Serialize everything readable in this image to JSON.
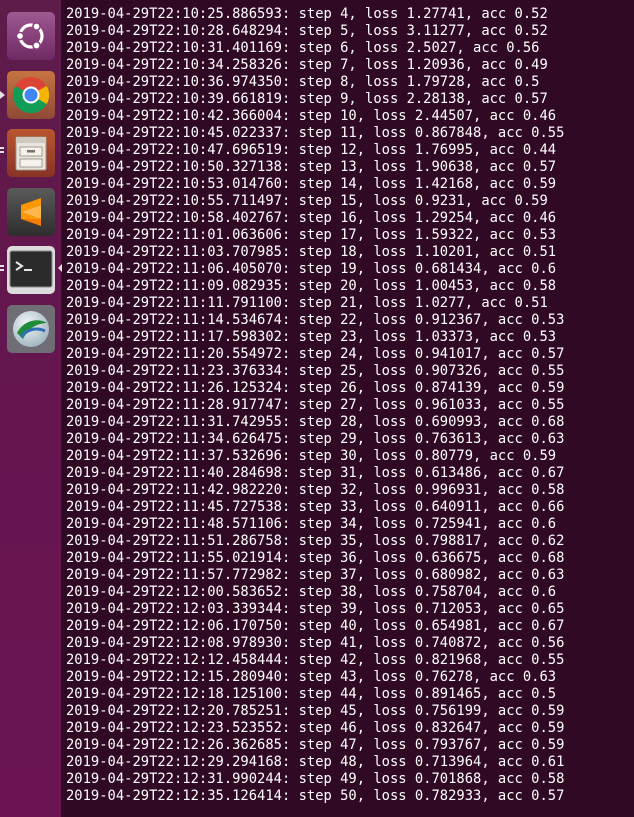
{
  "launcher": {
    "items": [
      {
        "icon": "ubuntu-dash-icon"
      },
      {
        "icon": "chrome-icon"
      },
      {
        "icon": "files-icon"
      },
      {
        "icon": "sublime-text-icon"
      },
      {
        "icon": "terminal-icon"
      },
      {
        "icon": "anyconnect-icon"
      }
    ]
  },
  "colors": {
    "terminal_background": "#300a24",
    "terminal_text": "#ffffff",
    "launcher_background": "#66154f"
  },
  "terminal": {
    "lines": [
      "2019-04-29T22:10:25.886593: step 4, loss 1.27741, acc 0.52",
      "2019-04-29T22:10:28.648294: step 5, loss 3.11277, acc 0.52",
      "2019-04-29T22:10:31.401169: step 6, loss 2.5027, acc 0.56",
      "2019-04-29T22:10:34.258326: step 7, loss 1.20936, acc 0.49",
      "2019-04-29T22:10:36.974350: step 8, loss 1.79728, acc 0.5",
      "2019-04-29T22:10:39.661819: step 9, loss 2.28138, acc 0.57",
      "2019-04-29T22:10:42.366004: step 10, loss 2.44507, acc 0.46",
      "2019-04-29T22:10:45.022337: step 11, loss 0.867848, acc 0.55",
      "2019-04-29T22:10:47.696519: step 12, loss 1.76995, acc 0.44",
      "2019-04-29T22:10:50.327138: step 13, loss 1.90638, acc 0.57",
      "2019-04-29T22:10:53.014760: step 14, loss 1.42168, acc 0.59",
      "2019-04-29T22:10:55.711497: step 15, loss 0.9231, acc 0.59",
      "2019-04-29T22:10:58.402767: step 16, loss 1.29254, acc 0.46",
      "2019-04-29T22:11:01.063606: step 17, loss 1.59322, acc 0.53",
      "2019-04-29T22:11:03.707985: step 18, loss 1.10201, acc 0.51",
      "2019-04-29T22:11:06.405070: step 19, loss 0.681434, acc 0.6",
      "2019-04-29T22:11:09.082935: step 20, loss 1.00453, acc 0.58",
      "2019-04-29T22:11:11.791100: step 21, loss 1.0277, acc 0.51",
      "2019-04-29T22:11:14.534674: step 22, loss 0.912367, acc 0.53",
      "2019-04-29T22:11:17.598302: step 23, loss 1.03373, acc 0.53",
      "2019-04-29T22:11:20.554972: step 24, loss 0.941017, acc 0.57",
      "2019-04-29T22:11:23.376334: step 25, loss 0.907326, acc 0.55",
      "2019-04-29T22:11:26.125324: step 26, loss 0.874139, acc 0.59",
      "2019-04-29T22:11:28.917747: step 27, loss 0.961033, acc 0.55",
      "2019-04-29T22:11:31.742955: step 28, loss 0.690993, acc 0.68",
      "2019-04-29T22:11:34.626475: step 29, loss 0.763613, acc 0.63",
      "2019-04-29T22:11:37.532696: step 30, loss 0.80779, acc 0.59",
      "2019-04-29T22:11:40.284698: step 31, loss 0.613486, acc 0.67",
      "2019-04-29T22:11:42.982220: step 32, loss 0.996931, acc 0.58",
      "2019-04-29T22:11:45.727538: step 33, loss 0.640911, acc 0.66",
      "2019-04-29T22:11:48.571106: step 34, loss 0.725941, acc 0.6",
      "2019-04-29T22:11:51.286758: step 35, loss 0.798817, acc 0.62",
      "2019-04-29T22:11:55.021914: step 36, loss 0.636675, acc 0.68",
      "2019-04-29T22:11:57.772982: step 37, loss 0.680982, acc 0.63",
      "2019-04-29T22:12:00.583652: step 38, loss 0.758704, acc 0.6",
      "2019-04-29T22:12:03.339344: step 39, loss 0.712053, acc 0.65",
      "2019-04-29T22:12:06.170750: step 40, loss 0.654981, acc 0.67",
      "2019-04-29T22:12:08.978930: step 41, loss 0.740872, acc 0.56",
      "2019-04-29T22:12:12.458444: step 42, loss 0.821968, acc 0.55",
      "2019-04-29T22:12:15.280940: step 43, loss 0.76278, acc 0.63",
      "2019-04-29T22:12:18.125100: step 44, loss 0.891465, acc 0.5",
      "2019-04-29T22:12:20.785251: step 45, loss 0.756199, acc 0.59",
      "2019-04-29T22:12:23.523552: step 46, loss 0.832647, acc 0.59",
      "2019-04-29T22:12:26.362685: step 47, loss 0.793767, acc 0.59",
      "2019-04-29T22:12:29.294168: step 48, loss 0.713964, acc 0.61",
      "2019-04-29T22:12:31.990244: step 49, loss 0.701868, acc 0.58",
      "2019-04-29T22:12:35.126414: step 50, loss 0.782933, acc 0.57"
    ]
  }
}
